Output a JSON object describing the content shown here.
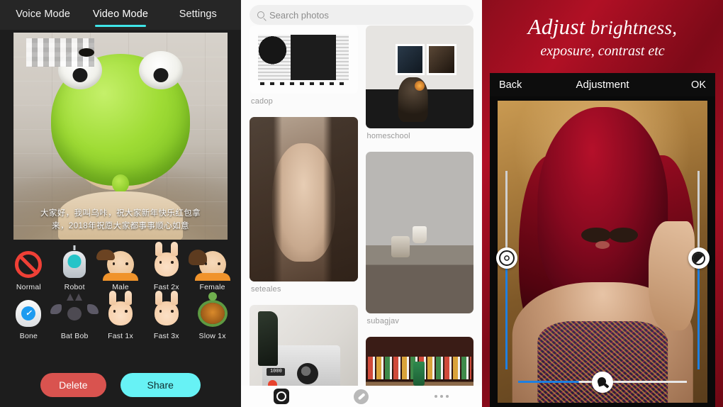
{
  "panel_voice": {
    "tabs": [
      {
        "label": "Voice Mode",
        "active": false
      },
      {
        "label": "Video Mode",
        "active": true
      },
      {
        "label": "Settings",
        "active": false
      }
    ],
    "accent_color": "#3fe5e8",
    "subtitle_line1": "大家好，我叫乌咔，祝大家新年快乐红包拿",
    "subtitle_line2": "来，2018年祝愿大家都事事顺心如意",
    "effects": [
      {
        "label": "Normal",
        "icon": "no-entry-icon"
      },
      {
        "label": "Robot",
        "icon": "robot-icon"
      },
      {
        "label": "Male",
        "icon": "male-face-icon"
      },
      {
        "label": "Fast 2x",
        "icon": "rabbit-icon"
      },
      {
        "label": "Female",
        "icon": "female-face-icon"
      },
      {
        "label": "Bone",
        "icon": "skull-icon"
      },
      {
        "label": "Bat Bob",
        "icon": "bat-icon"
      },
      {
        "label": "Fast 1x",
        "icon": "rabbit-icon"
      },
      {
        "label": "Fast 3x",
        "icon": "rabbit-icon"
      },
      {
        "label": "Slow 1x",
        "icon": "turtle-icon"
      }
    ],
    "delete_label": "Delete",
    "share_label": "Share",
    "delete_color": "#d9534f",
    "share_color": "#67f2f5"
  },
  "panel_photos": {
    "search_placeholder": "Search photos",
    "search_value": "",
    "captions": {
      "circuit": "cadop",
      "homeschool": "homeschool",
      "girl": "seteales",
      "still": "subagjav"
    },
    "bottom_nav": [
      {
        "icon": "camera-icon"
      },
      {
        "icon": "compass-icon"
      },
      {
        "icon": "more-dots-icon"
      }
    ]
  },
  "panel_adjust": {
    "promo_word": "Adjust",
    "promo_rest": "brightness,",
    "promo_line2": "exposure, contrast etc",
    "back_label": "Back",
    "title": "Adjustment",
    "ok_label": "OK",
    "brand_color": "#b11025",
    "slider_color": "#1f7fe0",
    "sliders": [
      {
        "name": "exposure",
        "orientation": "vertical",
        "position": "left",
        "value": 44
      },
      {
        "name": "contrast",
        "orientation": "vertical",
        "position": "right",
        "value": 44
      },
      {
        "name": "brightness",
        "orientation": "horizontal",
        "position": "bottom",
        "value": 36
      }
    ]
  }
}
